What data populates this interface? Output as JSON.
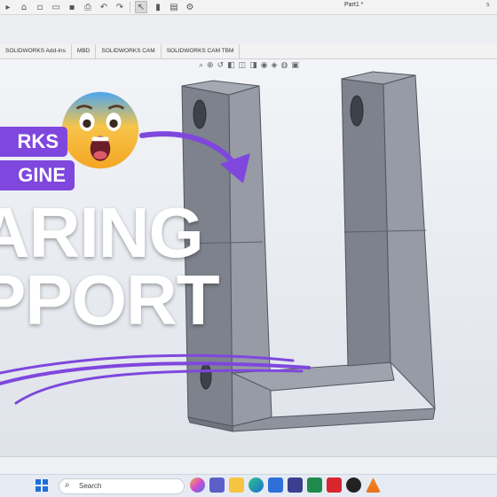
{
  "titlebar": {
    "doc_title": "Part1 *",
    "right_label": "s",
    "icons": [
      "solidworks-logo-icon",
      "home-icon",
      "new-file-icon",
      "open-icon",
      "save-icon",
      "print-icon",
      "undo-icon",
      "redo-icon",
      "select-icon",
      "rebuild-icon",
      "file-properties-icon",
      "options-icon"
    ]
  },
  "tabs": [
    "SOLIDWORKS Add-Ins",
    "MBD",
    "SOLIDWORKS CAM",
    "SOLIDWORKS CAM TBM"
  ],
  "overlay": {
    "badge_line1": "RKS",
    "badge_line2": "GINE",
    "headline_line1": "ARING",
    "headline_line2": "PPORT",
    "accent_color": "#7f47dd"
  },
  "taskbar": {
    "search_placeholder": "Search",
    "apps": [
      "copilot-icon",
      "teams-icon",
      "file-explorer-icon",
      "edge-icon",
      "store-icon",
      "app-icon",
      "excel-icon",
      "solidworks-icon",
      "media-icon",
      "vlc-icon"
    ]
  },
  "colors": {
    "model_face": "#8a8f99",
    "model_edge": "#5a5f68",
    "purple": "#7f47dd"
  }
}
